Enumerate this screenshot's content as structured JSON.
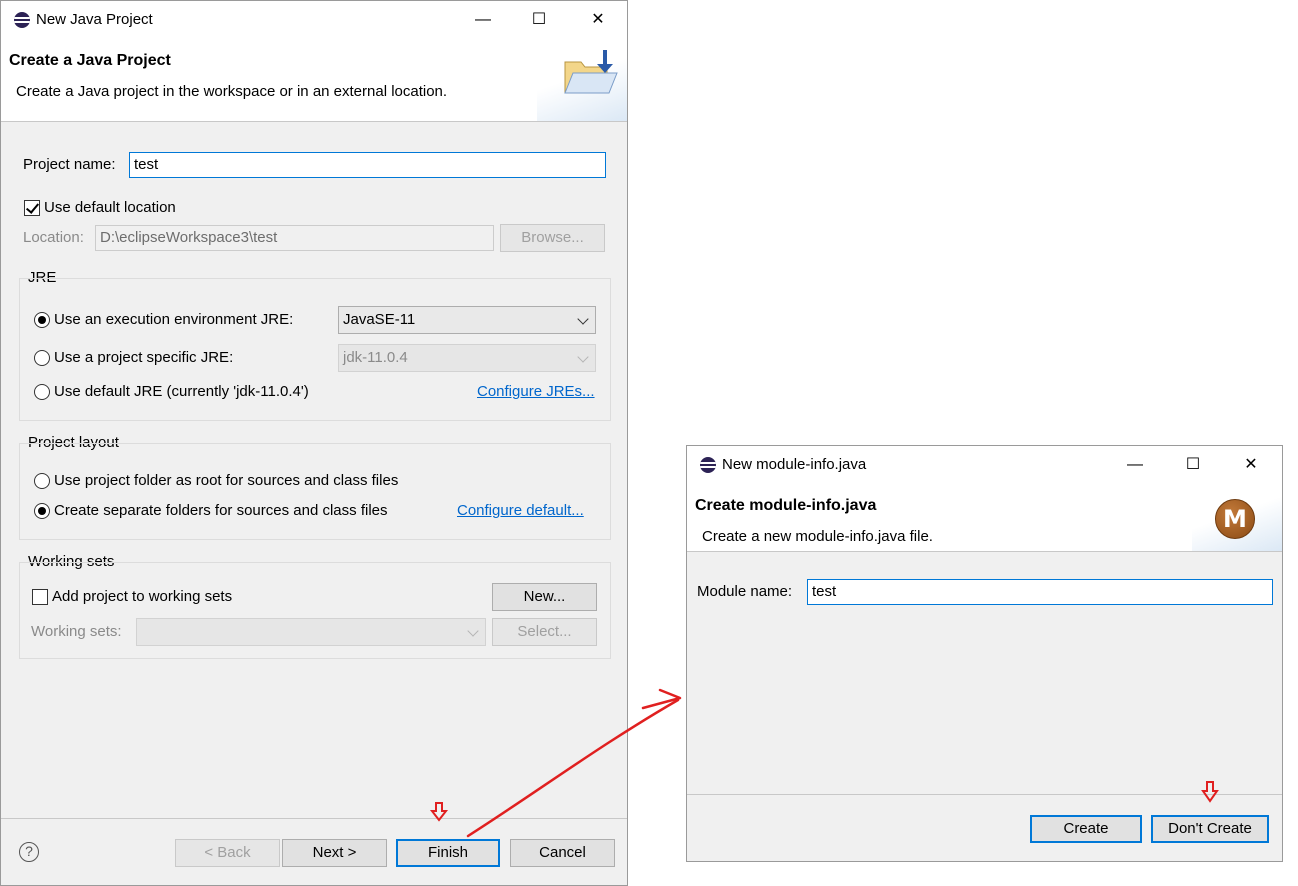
{
  "dialog1": {
    "title": "New Java Project",
    "window_controls": {
      "minimize": "—",
      "maximize": "☐",
      "close": "✕"
    },
    "banner": {
      "heading": "Create a Java Project",
      "description": "Create a Java project in the workspace or in an external location."
    },
    "project_name": {
      "label": "Project name:",
      "value": "test"
    },
    "use_default_location": {
      "label": "Use default location",
      "checked": true
    },
    "location": {
      "label": "Location:",
      "value": "D:\\eclipseWorkspace3\\test",
      "browse_label": "Browse..."
    },
    "jre": {
      "group_label": "JRE",
      "options": [
        {
          "label": "Use an execution environment JRE:",
          "selected": true,
          "combo": "JavaSE-11"
        },
        {
          "label": "Use a project specific JRE:",
          "selected": false,
          "combo": "jdk-11.0.4"
        },
        {
          "label": "Use default JRE (currently 'jdk-11.0.4')",
          "selected": false
        }
      ],
      "configure_link": "Configure JREs..."
    },
    "project_layout": {
      "group_label": "Project layout",
      "options": [
        {
          "label": "Use project folder as root for sources and class files",
          "selected": false
        },
        {
          "label": "Create separate folders for sources and class files",
          "selected": true
        }
      ],
      "configure_link": "Configure default..."
    },
    "working_sets": {
      "group_label": "Working sets",
      "add_label": "Add project to working sets",
      "add_checked": false,
      "new_button": "New...",
      "sets_label": "Working sets:",
      "select_button": "Select..."
    },
    "footer": {
      "help_icon": "?",
      "back": "< Back",
      "next": "Next >",
      "finish": "Finish",
      "cancel": "Cancel"
    }
  },
  "dialog2": {
    "title": "New module-info.java",
    "window_controls": {
      "minimize": "—",
      "maximize": "☐",
      "close": "✕"
    },
    "banner": {
      "heading": "Create module-info.java",
      "description": "Create a new module-info.java file.",
      "icon_letter": "M"
    },
    "module_name": {
      "label": "Module name:",
      "value": "test"
    },
    "footer": {
      "create": "Create",
      "dont_create": "Don't Create"
    }
  },
  "annotation_color": "#e02020"
}
